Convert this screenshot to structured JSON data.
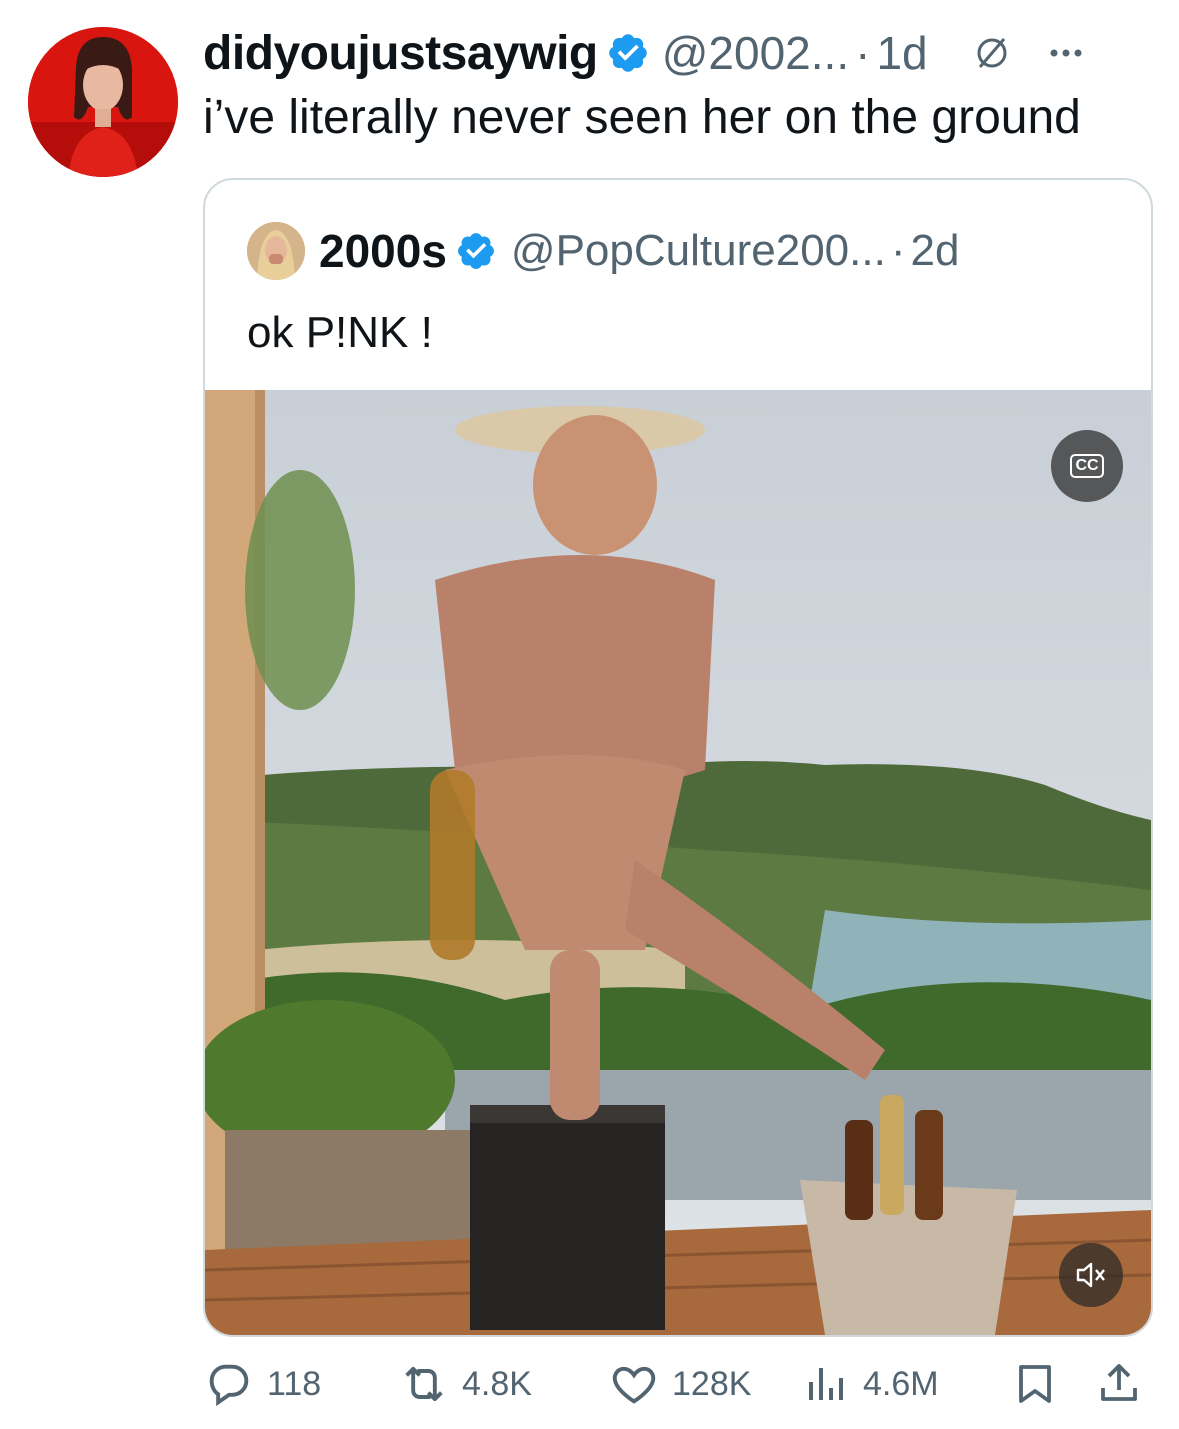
{
  "tweet": {
    "display_name": "didyoujustsaywig",
    "handle": "@2002...",
    "dot": "·",
    "time": "1d",
    "text": "i’ve literally never seen her on the ground",
    "avatar_icon": "avatar-woman-red-outfit",
    "verified_color": "#1d9bf0"
  },
  "quote": {
    "display_name": "2000s",
    "handle": "@PopCulture200...",
    "dot": "·",
    "time": "2d",
    "text": "ok P!NK !",
    "media": {
      "type": "video",
      "cc_label": "CC",
      "description_icon": "video-thumbnail"
    }
  },
  "actions": {
    "replies": "118",
    "reposts": "4.8K",
    "likes": "128K",
    "views": "4.6M"
  },
  "colors": {
    "text_primary": "#0f1419",
    "text_secondary": "#536471",
    "border": "#cfd9de"
  }
}
